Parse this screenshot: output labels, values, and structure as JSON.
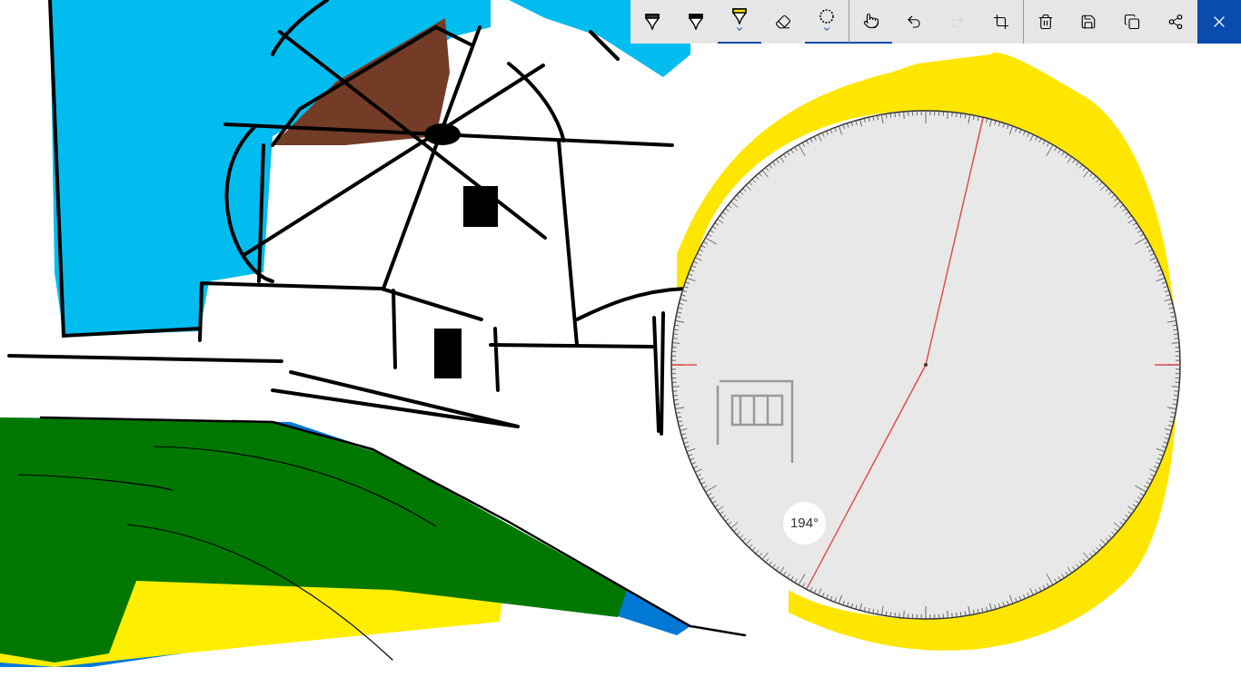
{
  "toolbar": {
    "tools": [
      {
        "kind": "ballpoint",
        "selected": false,
        "disabled": false,
        "menu": false
      },
      {
        "kind": "pencil",
        "selected": false,
        "disabled": false,
        "menu": false
      },
      {
        "kind": "highlighter",
        "selected": true,
        "disabled": false,
        "menu": true
      },
      {
        "kind": "eraser",
        "selected": false,
        "disabled": false,
        "menu": false
      },
      {
        "kind": "protractor",
        "selected": true,
        "disabled": false,
        "menu": true
      },
      {
        "kind": "touch",
        "selected": true,
        "disabled": false,
        "menu": false
      },
      {
        "kind": "undo",
        "selected": false,
        "disabled": false,
        "menu": false
      },
      {
        "kind": "redo",
        "selected": false,
        "disabled": true,
        "menu": false
      },
      {
        "kind": "crop",
        "selected": false,
        "disabled": false,
        "menu": false
      },
      {
        "kind": "delete",
        "selected": false,
        "disabled": false,
        "menu": false
      },
      {
        "kind": "save",
        "selected": false,
        "disabled": false,
        "menu": false
      },
      {
        "kind": "copy",
        "selected": false,
        "disabled": false,
        "menu": false
      },
      {
        "kind": "share",
        "selected": false,
        "disabled": false,
        "menu": false
      },
      {
        "kind": "close",
        "selected": false,
        "disabled": false,
        "menu": false
      }
    ]
  },
  "protractor": {
    "reading": "194°"
  }
}
